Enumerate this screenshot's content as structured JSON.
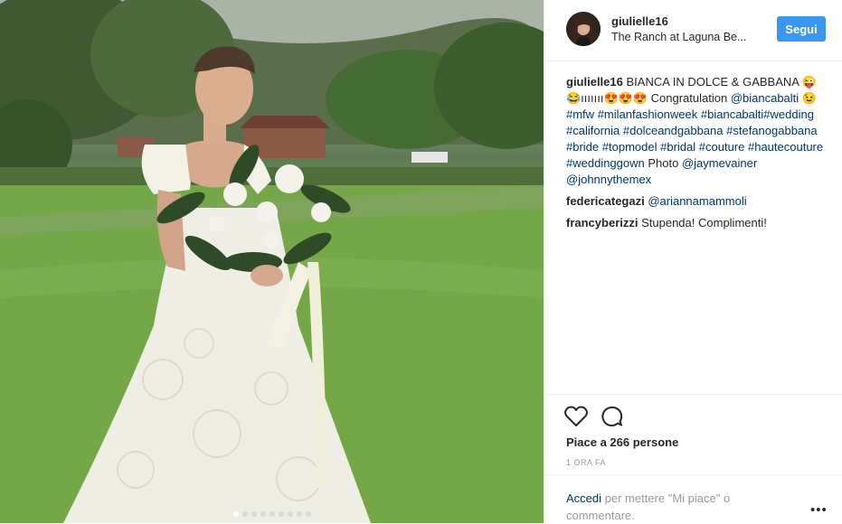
{
  "post": {
    "username": "giulielle16",
    "location": "The Ranch at Laguna Be...",
    "follow_label": "Segui"
  },
  "caption": {
    "user": "giulielle16",
    "text_parts": [
      {
        "t": "text",
        "v": "BIANCA IN DOLCE & GABBANA 😜😂ııııııı😍😍😍 Congratulation "
      },
      {
        "t": "tag",
        "v": "@biancabalti"
      },
      {
        "t": "text",
        "v": " 😉 "
      },
      {
        "t": "tag",
        "v": "#mfw"
      },
      {
        "t": "text",
        "v": " "
      },
      {
        "t": "tag",
        "v": "#milanfashionweek"
      },
      {
        "t": "text",
        "v": " "
      },
      {
        "t": "tag",
        "v": "#biancabalti#wedding"
      },
      {
        "t": "text",
        "v": " "
      },
      {
        "t": "tag",
        "v": "#california"
      },
      {
        "t": "text",
        "v": " "
      },
      {
        "t": "tag",
        "v": "#dolceandgabbana"
      },
      {
        "t": "text",
        "v": " "
      },
      {
        "t": "tag",
        "v": "#stefanogabbana"
      },
      {
        "t": "text",
        "v": " "
      },
      {
        "t": "tag",
        "v": "#bride"
      },
      {
        "t": "text",
        "v": " "
      },
      {
        "t": "tag",
        "v": "#topmodel"
      },
      {
        "t": "text",
        "v": " "
      },
      {
        "t": "tag",
        "v": "#bridal"
      },
      {
        "t": "text",
        "v": " "
      },
      {
        "t": "tag",
        "v": "#couture"
      },
      {
        "t": "text",
        "v": " "
      },
      {
        "t": "tag",
        "v": "#hautecouture"
      },
      {
        "t": "text",
        "v": " "
      },
      {
        "t": "tag",
        "v": "#weddinggown"
      },
      {
        "t": "text",
        "v": " Photo "
      },
      {
        "t": "tag",
        "v": "@jaymevainer"
      },
      {
        "t": "text",
        "v": " "
      },
      {
        "t": "tag",
        "v": "@johnnythemex"
      }
    ]
  },
  "comments": [
    {
      "user": "federicategazi",
      "mention": "@ariannamammoli",
      "text": ""
    },
    {
      "user": "francyberizzi",
      "mention": "",
      "text": "Stupenda! Complimenti!"
    }
  ],
  "actions": {
    "like_icon": "heart-icon",
    "comment_icon": "comment-icon",
    "likes_text": "Piace a 266 persone",
    "timestamp": "1 ORA FA"
  },
  "login": {
    "link": "Accedi",
    "text": " per mettere \"Mi piace\" o commentare.",
    "more_label": "•••"
  },
  "carousel": {
    "count": 9,
    "active_index": 0
  },
  "colors": {
    "accent": "#3897f0",
    "link": "#003569",
    "muted": "#999999"
  }
}
